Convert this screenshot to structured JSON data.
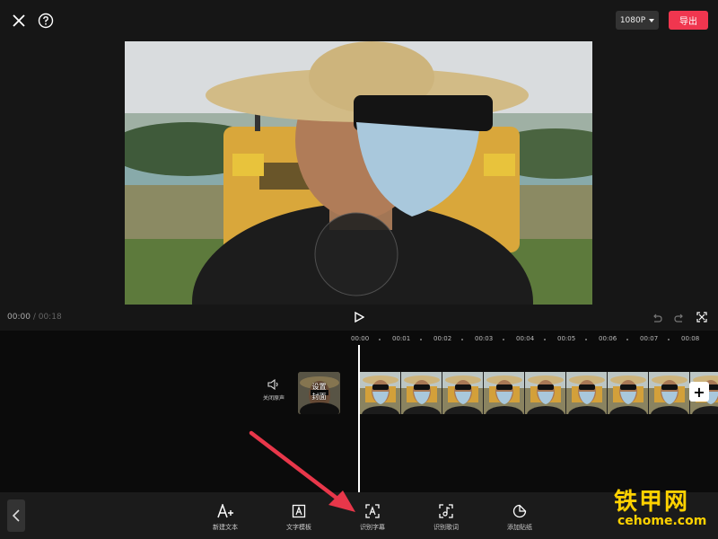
{
  "header": {
    "close_icon": "close-icon",
    "help_icon": "question-circle-icon",
    "resolution_label": "1080P",
    "export_label": "导出",
    "export_color": "#f0364f"
  },
  "player": {
    "current_time": "00:00",
    "separator": "/",
    "total_time": "00:18"
  },
  "timeline": {
    "ruler_labels": [
      "00:00",
      "00:01",
      "00:02",
      "00:03",
      "00:04",
      "00:05",
      "00:06",
      "00:07",
      "00:08"
    ],
    "audio_toggle_label": "关闭原声",
    "cover_label": "设置\n封面",
    "add_clip_label": "+"
  },
  "toolbar": {
    "items": [
      {
        "label": "新建文本",
        "icon": "add-text-icon"
      },
      {
        "label": "文字模板",
        "icon": "text-template-icon"
      },
      {
        "label": "识别字幕",
        "icon": "caption-recognize-icon"
      },
      {
        "label": "识别歌词",
        "icon": "lyrics-recognize-icon"
      },
      {
        "label": "添加贴纸",
        "icon": "sticker-icon"
      }
    ]
  },
  "watermark": {
    "main": "铁甲网",
    "sub": "cehome.com"
  }
}
